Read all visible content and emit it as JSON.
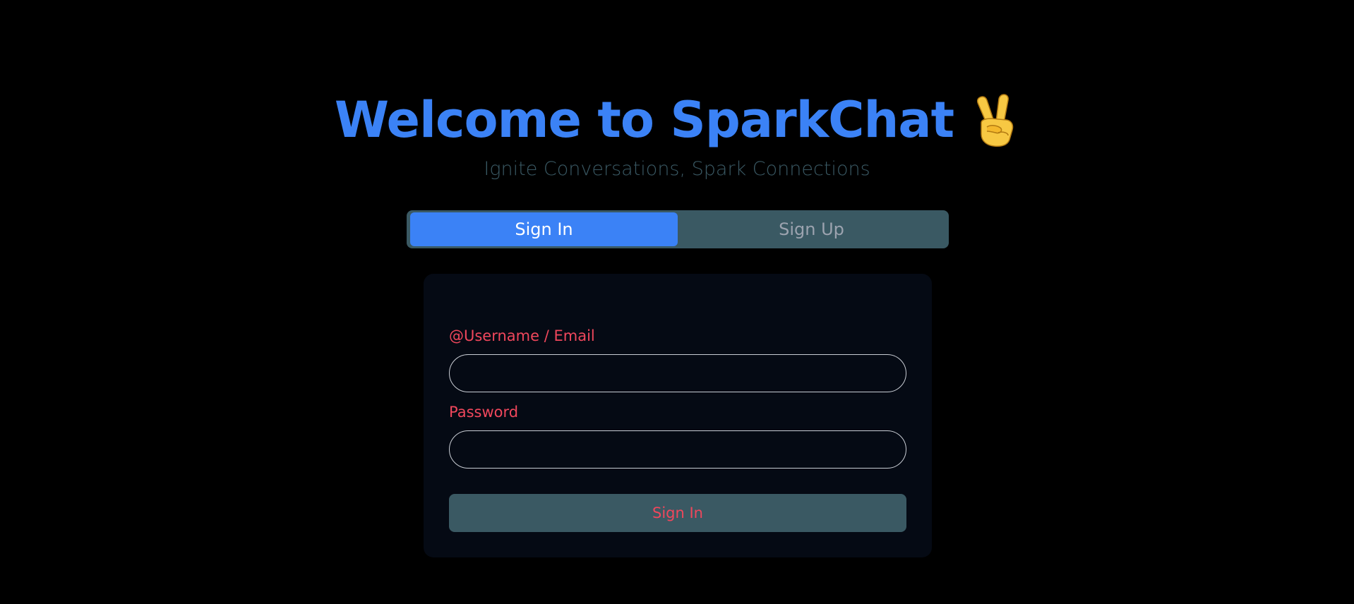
{
  "header": {
    "title": "Welcome to SparkChat",
    "title_icon": "victory-hand-emoji",
    "subtitle": "Ignite Conversations, Spark Connections"
  },
  "tabs": [
    {
      "label": "Sign In",
      "active": true
    },
    {
      "label": "Sign Up",
      "active": false
    }
  ],
  "form": {
    "username_label": "@Username / Email",
    "username_value": "",
    "password_label": "Password",
    "password_value": "",
    "submit_label": "Sign In"
  },
  "colors": {
    "background": "#000000",
    "accent": "#3b82f6",
    "subtitle": "#3a5964",
    "tab_bar": "#3a5963",
    "label": "#f0475c",
    "card": "#050a14",
    "field_border": "#c9cdd4"
  }
}
